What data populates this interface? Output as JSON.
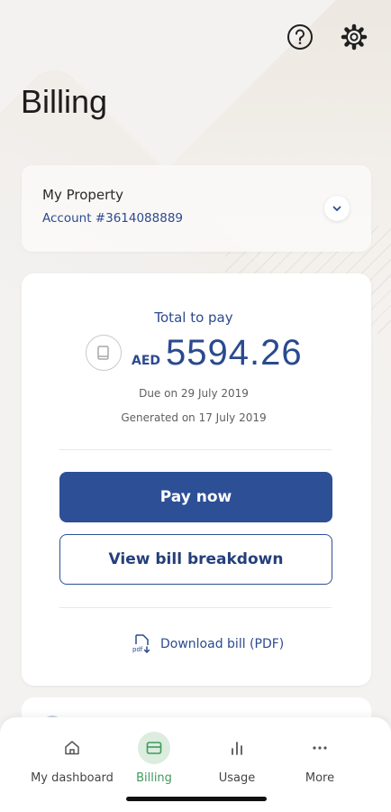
{
  "header": {
    "title": "Billing",
    "help_icon": "question-circle-icon",
    "settings_icon": "gear-icon"
  },
  "property": {
    "name": "My Property",
    "account": "Account #3614088889"
  },
  "bill": {
    "total_label": "Total to pay",
    "currency": "AED",
    "amount": "5594.26",
    "due": "Due on 29 July 2019",
    "generated": "Generated on 17 July 2019",
    "pay_label": "Pay now",
    "breakdown_label": "View bill breakdown",
    "download_label": "Download bill (PDF)"
  },
  "nav": {
    "items": [
      {
        "label": "My dashboard",
        "icon": "home-icon"
      },
      {
        "label": "Billing",
        "icon": "bill-icon"
      },
      {
        "label": "Usage",
        "icon": "bar-chart-icon"
      },
      {
        "label": "More",
        "icon": "more-dots-icon"
      }
    ],
    "active_index": 1
  },
  "colors": {
    "accent": "#2d4f96",
    "active_nav": "#3f9a5b",
    "background": "#f3f2f1"
  }
}
